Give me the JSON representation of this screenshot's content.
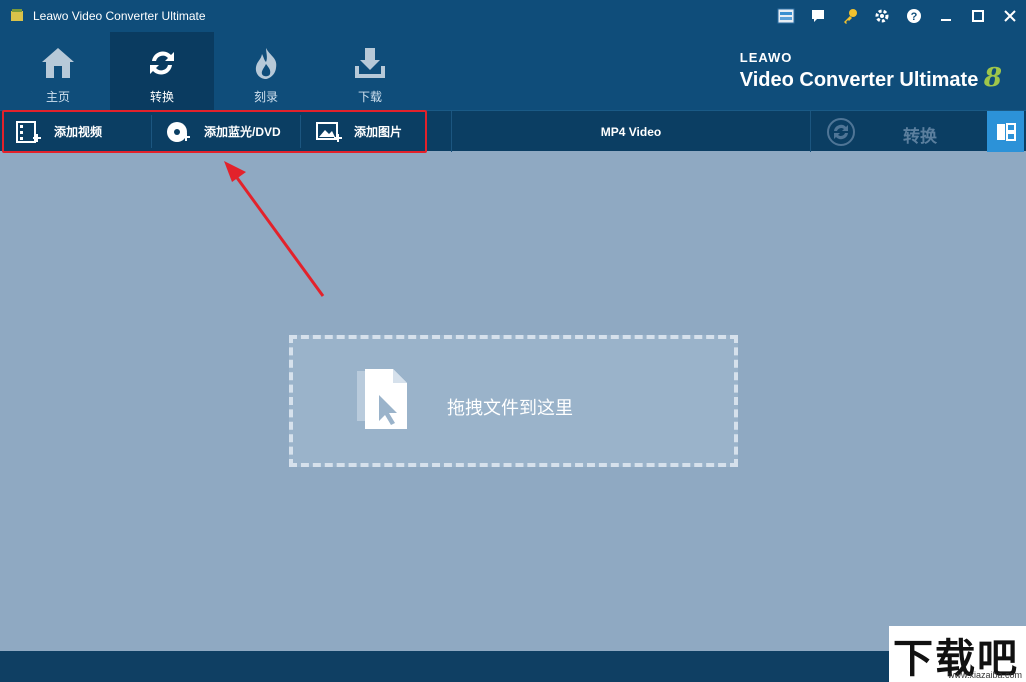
{
  "window": {
    "title": "Leawo Video Converter Ultimate"
  },
  "titlebar_icons": [
    "register-icon",
    "feedback-icon",
    "key-icon",
    "settings-icon",
    "help-icon",
    "minimize-icon",
    "maximize-icon",
    "close-icon"
  ],
  "nav": {
    "items": [
      {
        "label": "主页",
        "icon": "home-icon"
      },
      {
        "label": "转换",
        "icon": "convert-icon",
        "active": true
      },
      {
        "label": "刻录",
        "icon": "burn-icon"
      },
      {
        "label": "下载",
        "icon": "download-icon"
      }
    ],
    "brand": {
      "leawo": "LEAWO",
      "name": "Video Converter Ultimate",
      "version": "8"
    }
  },
  "toolbar": {
    "add_video": "添加视频",
    "add_bluray": "添加蓝光/DVD",
    "add_photo": "添加图片",
    "format": "MP4 Video",
    "convert": "转换"
  },
  "drop_zone": {
    "text": "拖拽文件到这里"
  },
  "watermark": {
    "big": "下载吧",
    "small": "www.xiazaiba.com"
  },
  "colors": {
    "header": "#0f4d7a",
    "toolbar": "#0b3e63",
    "workspace": "#8fa9c2",
    "highlight": "#e3222b",
    "accent": "#2c92d8"
  }
}
